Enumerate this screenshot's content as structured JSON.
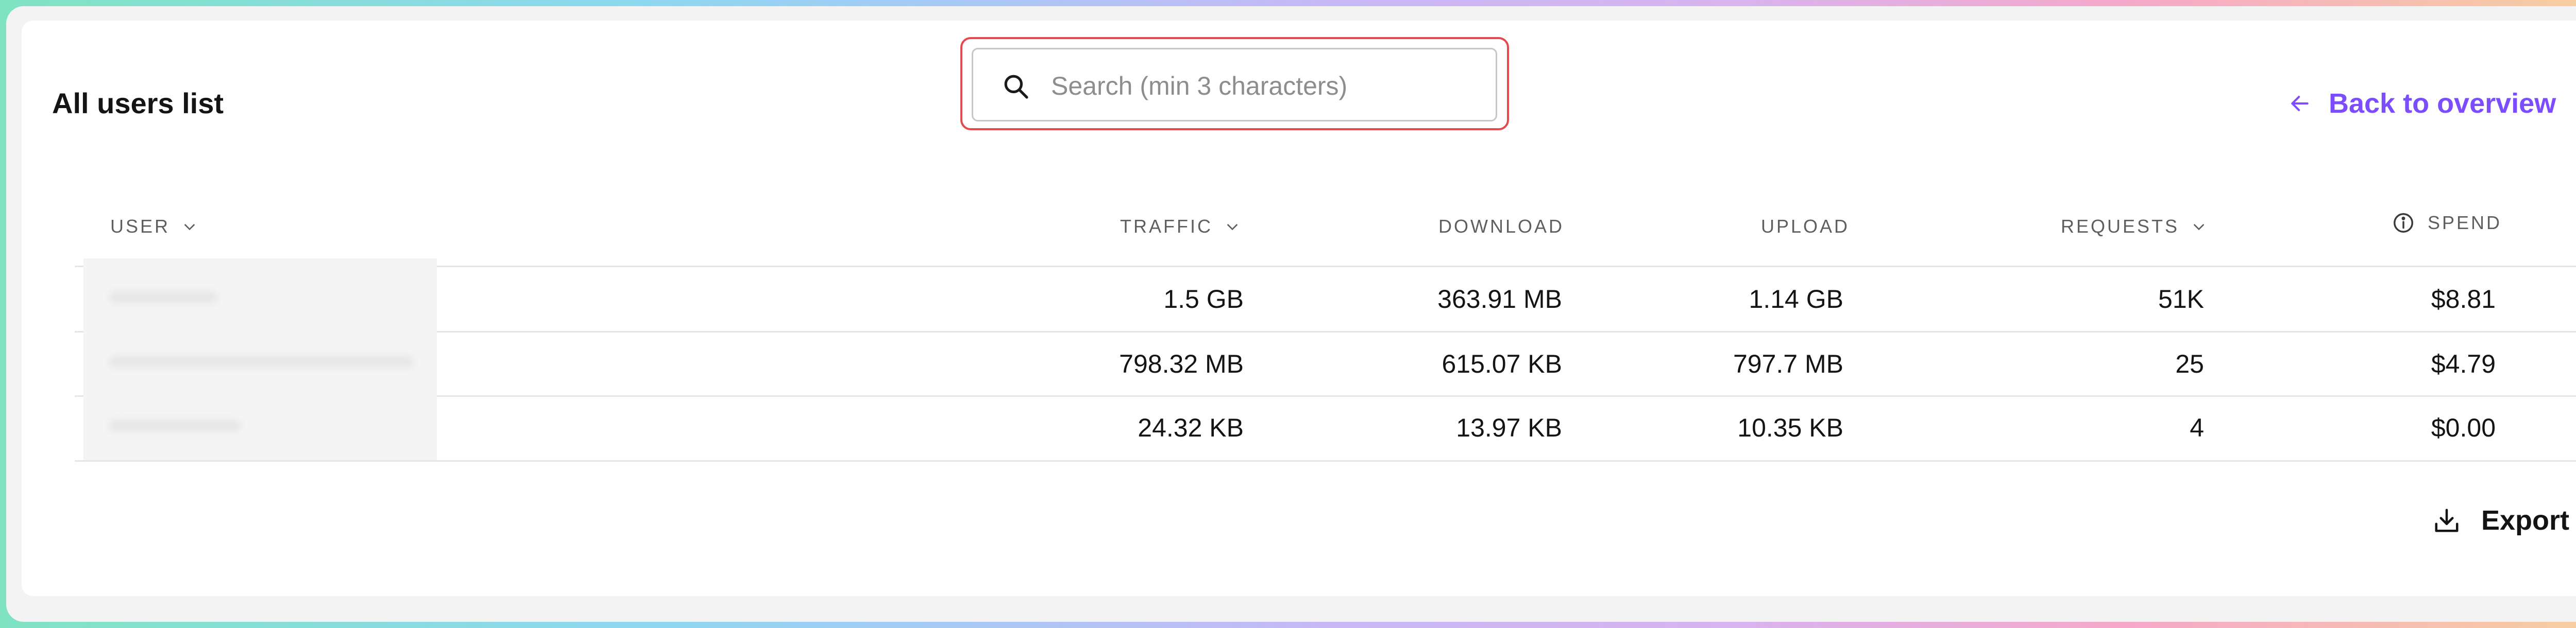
{
  "page": {
    "title": "All users list"
  },
  "search": {
    "placeholder": "Search (min 3 characters)",
    "value": "",
    "icon": "search-icon"
  },
  "back_link": {
    "label": "Back to overview",
    "icon": "arrow-left-icon",
    "color": "#7c4dff"
  },
  "table": {
    "columns": [
      {
        "key": "user",
        "label": "USER",
        "sortable": true
      },
      {
        "key": "traffic",
        "label": "TRAFFIC",
        "sortable": true
      },
      {
        "key": "download",
        "label": "DOWNLOAD",
        "sortable": false
      },
      {
        "key": "upload",
        "label": "UPLOAD",
        "sortable": false
      },
      {
        "key": "requests",
        "label": "REQUESTS",
        "sortable": true
      },
      {
        "key": "spend",
        "label": "SPEND",
        "sortable": false,
        "icon": "info-icon"
      }
    ],
    "rows": [
      {
        "user": "",
        "traffic": "1.5 GB",
        "download": "363.91 MB",
        "upload": "1.14 GB",
        "requests": "51K",
        "spend": "$8.81"
      },
      {
        "user": "",
        "traffic": "798.32 MB",
        "download": "615.07 KB",
        "upload": "797.7 MB",
        "requests": "25",
        "spend": "$4.79"
      },
      {
        "user": "",
        "traffic": "24.32 KB",
        "download": "13.97 KB",
        "upload": "10.35 KB",
        "requests": "4",
        "spend": "$0.00"
      }
    ]
  },
  "export": {
    "label": "Export",
    "icon": "download-icon"
  },
  "colors": {
    "accent": "#7c4dff",
    "focus_outline": "#e5484d"
  }
}
